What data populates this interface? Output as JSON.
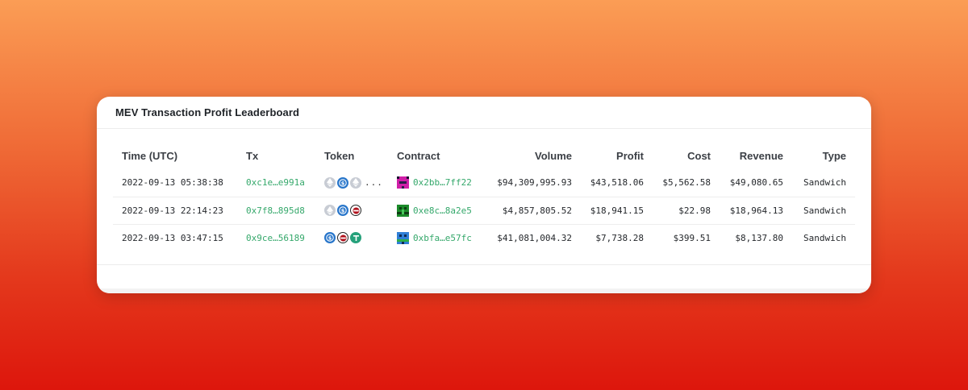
{
  "card": {
    "title": "MEV Transaction Profit Leaderboard"
  },
  "table": {
    "headers": {
      "time": "Time (UTC)",
      "tx": "Tx",
      "token": "Token",
      "contract": "Contract",
      "volume": "Volume",
      "profit": "Profit",
      "cost": "Cost",
      "revenue": "Revenue",
      "type": "Type"
    },
    "rows": [
      {
        "time": "2022-09-13 05:38:38",
        "tx": "0xc1e…e991a",
        "tokens": [
          "eth-icon",
          "usdc-icon",
          "eth-icon"
        ],
        "tokens_more": "...",
        "contract": "0x2bb…7ff22",
        "volume": "$94,309,995.93",
        "profit": "$43,518.06",
        "cost": "$5,562.58",
        "revenue": "$49,080.65",
        "type": "Sandwich"
      },
      {
        "time": "2022-09-13 22:14:23",
        "tx": "0x7f8…895d8",
        "tokens": [
          "eth-icon",
          "usdc-icon",
          "mev-icon"
        ],
        "tokens_more": "",
        "contract": "0xe8c…8a2e5",
        "volume": "$4,857,805.52",
        "profit": "$18,941.15",
        "cost": "$22.98",
        "revenue": "$18,964.13",
        "type": "Sandwich"
      },
      {
        "time": "2022-09-13 03:47:15",
        "tx": "0x9ce…56189",
        "tokens": [
          "usdc-icon",
          "mev-icon",
          "usdt-icon"
        ],
        "tokens_more": "",
        "contract": "0xbfa…e57fc",
        "volume": "$41,081,004.32",
        "profit": "$7,738.28",
        "cost": "$399.51",
        "revenue": "$8,137.80",
        "type": "Sandwich"
      }
    ]
  },
  "colors": {
    "link": "#35a86b",
    "background_top": "#fb9d55",
    "background_bottom": "#dd160c"
  }
}
